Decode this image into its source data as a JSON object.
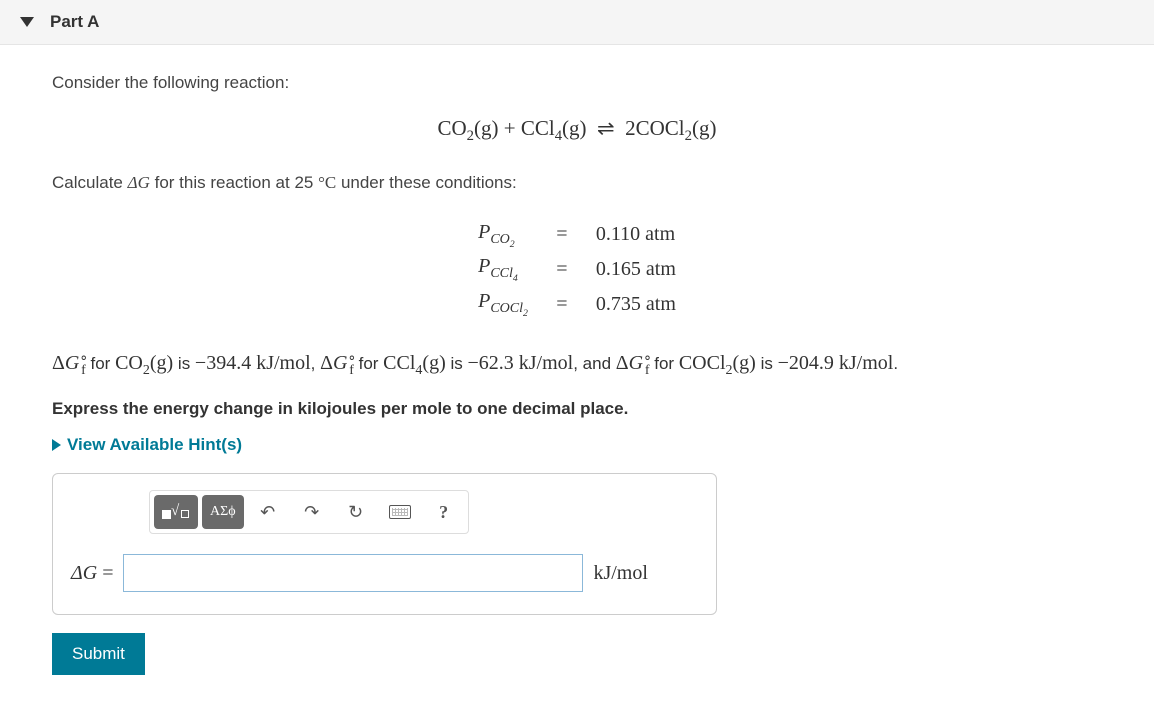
{
  "part": {
    "label": "Part A"
  },
  "intro": "Consider the following reaction:",
  "equation": "CO₂(g) + CCl₄(g)  ⇌  2COCl₂(g)",
  "calc_line_prefix": "Calculate ",
  "calc_line_mid": " for this reaction at 25 ",
  "calc_line_suffix": " under these conditions:",
  "deltaG": "ΔG",
  "degC": "°C",
  "conditions": [
    {
      "symbol_html": "P<sub>CO₂</sub>",
      "value": "0.110 atm"
    },
    {
      "symbol_html": "P<sub>CCl₄</sub>",
      "value": "0.165 atm"
    },
    {
      "symbol_html": "P<sub>COCl₂</sub>",
      "value": "0.735 atm"
    }
  ],
  "gibbs": {
    "dg_symbol": "ΔG",
    "for": " for ",
    "is": " is ",
    "and": ", and ",
    "comma": ", ",
    "period": ".",
    "sp1": "CO₂(g)",
    "v1": "−394.4 kJ/mol",
    "sp2": "CCl₄(g)",
    "v2": "−62.3 kJ/mol",
    "sp3": "COCl₂(g)",
    "v3": "−204.9 kJ/mol"
  },
  "instruction": "Express the energy change in kilojoules per mole to one decimal place.",
  "hints_label": "View Available Hint(s)",
  "toolbar": {
    "templates": "templates",
    "greek": "ΑΣϕ",
    "undo": "↶",
    "redo": "↷",
    "reset": "↻",
    "keyboard": "keyboard",
    "help": "?"
  },
  "answer": {
    "label": "ΔG =",
    "unit": "kJ/mol",
    "value": ""
  },
  "submit": "Submit"
}
